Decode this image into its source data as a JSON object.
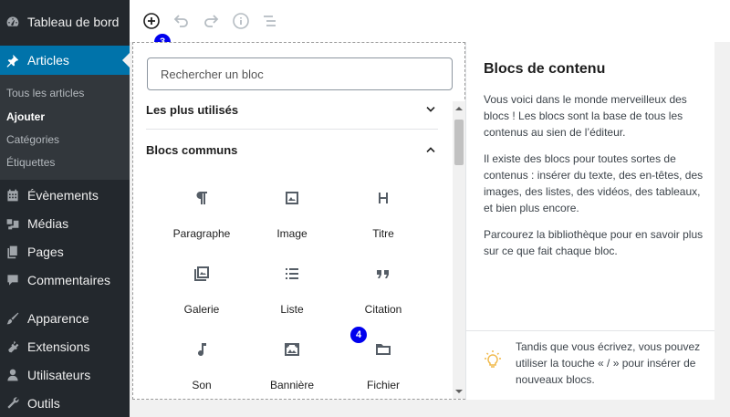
{
  "sidebar": {
    "dashboard": "Tableau de bord",
    "articles": "Articles",
    "sub": [
      "Tous les articles",
      "Ajouter",
      "Catégories",
      "Étiquettes"
    ],
    "events": "Évènements",
    "media": "Médias",
    "pages": "Pages",
    "comments": "Commentaires",
    "appearance": "Apparence",
    "extensions": "Extensions",
    "users": "Utilisateurs",
    "tools": "Outils"
  },
  "badges": {
    "b3": "3",
    "b4": "4"
  },
  "inserter": {
    "search_placeholder": "Rechercher un bloc",
    "most_used": "Les plus utilisés",
    "common": "Blocs communs",
    "blocks": [
      "Paragraphe",
      "Image",
      "Titre",
      "Galerie",
      "Liste",
      "Citation",
      "Son",
      "Bannière",
      "Fichier"
    ]
  },
  "help": {
    "title": "Blocs de contenu",
    "p1": "Vous voici dans le monde merveilleux des blocs ! Les blocs sont la base de tous les contenus au sien de l’éditeur.",
    "p2": "Il existe des blocs pour toutes sortes de contenus : insérer du texte, des en-têtes, des images, des listes, des vidéos, des tableaux, et bien plus encore.",
    "p3": "Parcourez la bibliothèque pour en savoir plus sur ce que fait chaque bloc.",
    "tip": "Tandis que vous écrivez, vous pouvez utiliser la touche « / » pour insérer de nouveaux blocs."
  },
  "colors": {
    "sidebar": "#23282d",
    "active": "#0073aa",
    "badge": "#0000ee"
  }
}
